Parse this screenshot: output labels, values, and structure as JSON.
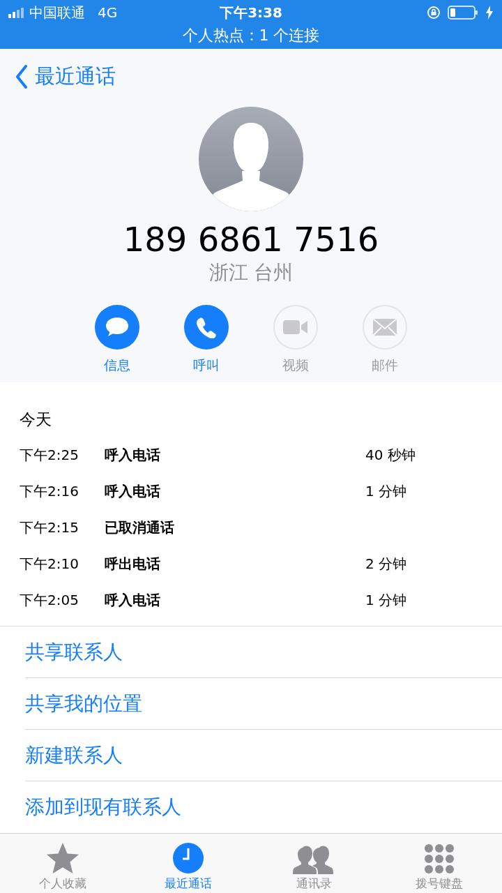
{
  "status_bar": {
    "carrier": "中国联通",
    "network": "4G",
    "time": "下午3:38",
    "hotspot": "个人热点：1 个连接"
  },
  "nav": {
    "back": "最近通话"
  },
  "contact": {
    "number": "189 6861 7516",
    "location": "浙江 台州"
  },
  "actions": [
    {
      "kind": "message",
      "label": "信息",
      "disabled": false
    },
    {
      "kind": "call",
      "label": "呼叫",
      "disabled": false
    },
    {
      "kind": "video",
      "label": "视频",
      "disabled": true
    },
    {
      "kind": "mail",
      "label": "邮件",
      "disabled": true
    }
  ],
  "calls": {
    "heading": "今天",
    "rows": [
      {
        "time": "下午2:25",
        "type": "呼入电话",
        "duration": "40 秒钟"
      },
      {
        "time": "下午2:16",
        "type": "呼入电话",
        "duration": "1 分钟"
      },
      {
        "time": "下午2:15",
        "type": "已取消通话"
      },
      {
        "time": "下午2:10",
        "type": "呼出电话",
        "duration": "2 分钟"
      },
      {
        "time": "下午2:05",
        "type": "呼入电话",
        "duration": "1 分钟"
      }
    ]
  },
  "options": [
    "共享联系人",
    "共享我的位置",
    "新建联系人",
    "添加到现有联系人"
  ],
  "tabs": [
    {
      "kind": "favorites",
      "label": "个人收藏",
      "selected": false
    },
    {
      "kind": "recents",
      "label": "最近通话",
      "selected": true
    },
    {
      "kind": "contacts",
      "label": "通讯录",
      "selected": false
    },
    {
      "kind": "keypad",
      "label": "拨号键盘",
      "selected": false
    }
  ]
}
